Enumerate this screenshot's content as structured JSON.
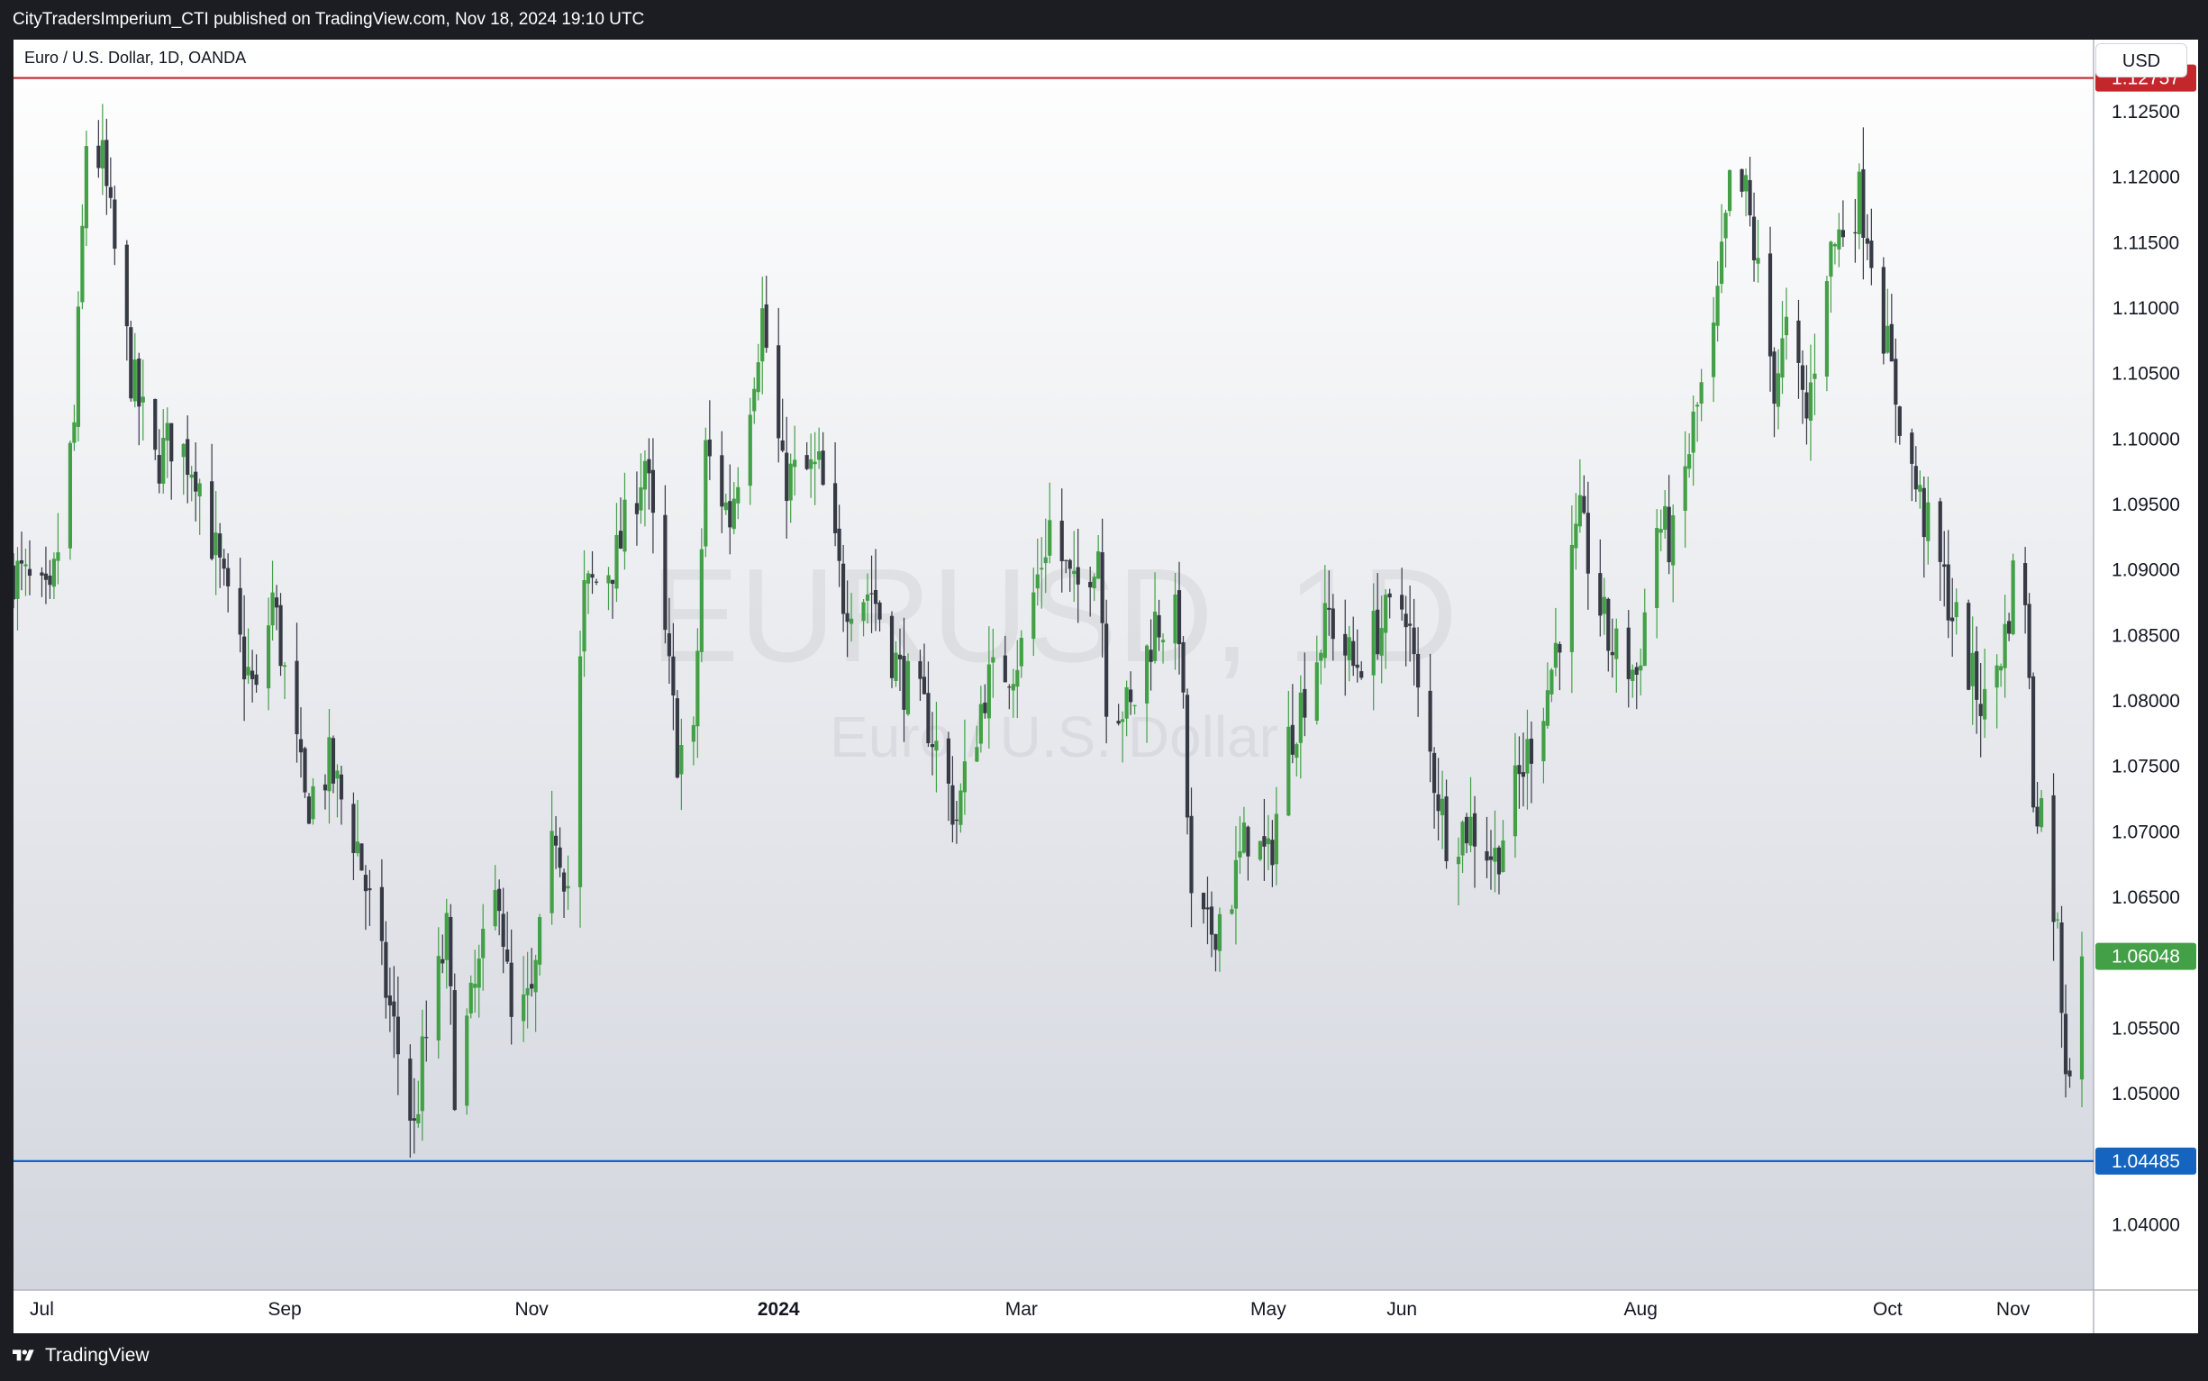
{
  "header": {
    "publish_info": "CityTradersImperium_CTI published on TradingView.com, Nov 18, 2024 19:10 UTC"
  },
  "chart": {
    "symbol_title": "Euro / U.S. Dollar, 1D, OANDA",
    "currency": "USD",
    "watermark_main": "EURUSD, 1D",
    "watermark_sub": "Euro / U.S. Dollar"
  },
  "footer": {
    "brand": "TradingView",
    "logo_icon": "tradingview-logo-icon"
  },
  "colors": {
    "up": "#43a047",
    "down": "#363a45",
    "resistance": "#c2282b",
    "support": "#1565c0",
    "last_price": "#43a047"
  },
  "chart_data": {
    "type": "candlestick",
    "symbol": "EURUSD",
    "interval": "1D",
    "broker": "OANDA",
    "ylim": [
      1.035,
      1.1305
    ],
    "y_ticks": [
      "1.04000",
      "1.04500",
      "1.05000",
      "1.05500",
      "1.06000",
      "1.06500",
      "1.07000",
      "1.07500",
      "1.08000",
      "1.08500",
      "1.09000",
      "1.09500",
      "1.10000",
      "1.10500",
      "1.11000",
      "1.11500",
      "1.12000",
      "1.12500"
    ],
    "y_tick_labels_shown": [
      "1.04000",
      "1.05000",
      "1.05500",
      "1.06500",
      "1.07000",
      "1.07500",
      "1.08000",
      "1.08500",
      "1.09000",
      "1.09500",
      "1.10000",
      "1.10500",
      "1.11000",
      "1.11500",
      "1.12000",
      "1.12500"
    ],
    "x_ticks": [
      {
        "label": "Jul",
        "date": "2023-07-03",
        "bold": false
      },
      {
        "label": "Sep",
        "date": "2023-09-01",
        "bold": false
      },
      {
        "label": "Nov",
        "date": "2023-11-01",
        "bold": false
      },
      {
        "label": "2024",
        "date": "2024-01-01",
        "bold": true
      },
      {
        "label": "Mar",
        "date": "2024-03-01",
        "bold": false
      },
      {
        "label": "May",
        "date": "2024-05-01",
        "bold": false
      },
      {
        "label": "Jun",
        "date": "2024-06-03",
        "bold": false
      },
      {
        "label": "Aug",
        "date": "2024-08-01",
        "bold": false
      },
      {
        "label": "Oct",
        "date": "2024-10-01",
        "bold": false
      },
      {
        "label": "Nov",
        "date": "2024-11-01",
        "bold": false
      }
    ],
    "horizontal_lines": [
      {
        "label": "1.12757",
        "value": 1.12757,
        "color": "#c2282b"
      },
      {
        "label": "1.04485",
        "value": 1.04485,
        "color": "#1565c0"
      }
    ],
    "last_price": {
      "label": "1.06048",
      "value": 1.06048
    },
    "anchors": [
      {
        "date": "2023-06-26",
        "close": 1.09
      },
      {
        "date": "2023-07-05",
        "close": 1.087
      },
      {
        "date": "2023-07-11",
        "close": 1.101
      },
      {
        "date": "2023-07-14",
        "close": 1.1228
      },
      {
        "date": "2023-07-18",
        "close": 1.121
      },
      {
        "date": "2023-07-25",
        "close": 1.105
      },
      {
        "date": "2023-07-31",
        "close": 1.098
      },
      {
        "date": "2023-08-04",
        "close": 1.1
      },
      {
        "date": "2023-08-10",
        "close": 1.098
      },
      {
        "date": "2023-08-18",
        "close": 1.087
      },
      {
        "date": "2023-08-25",
        "close": 1.08
      },
      {
        "date": "2023-08-29",
        "close": 1.088
      },
      {
        "date": "2023-09-06",
        "close": 1.072
      },
      {
        "date": "2023-09-12",
        "close": 1.075
      },
      {
        "date": "2023-09-19",
        "close": 1.069
      },
      {
        "date": "2023-09-26",
        "close": 1.058
      },
      {
        "date": "2023-10-03",
        "close": 1.047
      },
      {
        "date": "2023-10-05",
        "close": 1.0525
      },
      {
        "date": "2023-10-11",
        "close": 1.062
      },
      {
        "date": "2023-10-13",
        "close": 1.051
      },
      {
        "date": "2023-10-24",
        "close": 1.066
      },
      {
        "date": "2023-10-27",
        "close": 1.055
      },
      {
        "date": "2023-11-01",
        "close": 1.057
      },
      {
        "date": "2023-11-07",
        "close": 1.0703
      },
      {
        "date": "2023-11-10",
        "close": 1.066
      },
      {
        "date": "2023-11-14",
        "close": 1.088
      },
      {
        "date": "2023-11-22",
        "close": 1.091
      },
      {
        "date": "2023-11-29",
        "close": 1.0985
      },
      {
        "date": "2023-12-07",
        "close": 1.0762
      },
      {
        "date": "2023-12-11",
        "close": 1.0765
      },
      {
        "date": "2023-12-14",
        "close": 1.099
      },
      {
        "date": "2023-12-20",
        "close": 1.094
      },
      {
        "date": "2023-12-28",
        "close": 1.1095
      },
      {
        "date": "2024-01-02",
        "close": 1.097
      },
      {
        "date": "2024-01-11",
        "close": 1.0975
      },
      {
        "date": "2024-01-17",
        "close": 1.088
      },
      {
        "date": "2024-01-24",
        "close": 1.0885
      },
      {
        "date": "2024-01-31",
        "close": 1.082
      },
      {
        "date": "2024-02-07",
        "close": 1.0785
      },
      {
        "date": "2024-02-14",
        "close": 1.071
      },
      {
        "date": "2024-02-21",
        "close": 1.081
      },
      {
        "date": "2024-02-28",
        "close": 1.083
      },
      {
        "date": "2024-03-01",
        "close": 1.084
      },
      {
        "date": "2024-03-08",
        "close": 1.0935
      },
      {
        "date": "2024-03-14",
        "close": 1.088
      },
      {
        "date": "2024-03-20",
        "close": 1.092
      },
      {
        "date": "2024-03-22",
        "close": 1.0808
      },
      {
        "date": "2024-03-28",
        "close": 1.079
      },
      {
        "date": "2024-04-03",
        "close": 1.086
      },
      {
        "date": "2024-04-09",
        "close": 1.086
      },
      {
        "date": "2024-04-12",
        "close": 1.064
      },
      {
        "date": "2024-04-16",
        "close": 1.062
      },
      {
        "date": "2024-04-22",
        "close": 1.0655
      },
      {
        "date": "2024-04-26",
        "close": 1.07
      },
      {
        "date": "2024-05-01",
        "close": 1.0675
      },
      {
        "date": "2024-05-06",
        "close": 1.077
      },
      {
        "date": "2024-05-16",
        "close": 1.0865
      },
      {
        "date": "2024-05-22",
        "close": 1.0825
      },
      {
        "date": "2024-05-28",
        "close": 1.0855
      },
      {
        "date": "2024-06-04",
        "close": 1.0875
      },
      {
        "date": "2024-06-07",
        "close": 1.08
      },
      {
        "date": "2024-06-14",
        "close": 1.07
      },
      {
        "date": "2024-06-20",
        "close": 1.0705
      },
      {
        "date": "2024-06-26",
        "close": 1.068
      },
      {
        "date": "2024-07-02",
        "close": 1.074
      },
      {
        "date": "2024-07-09",
        "close": 1.081
      },
      {
        "date": "2024-07-17",
        "close": 1.0935
      },
      {
        "date": "2024-07-24",
        "close": 1.0845
      },
      {
        "date": "2024-07-31",
        "close": 1.082
      },
      {
        "date": "2024-08-05",
        "close": 1.0935
      },
      {
        "date": "2024-08-09",
        "close": 1.092
      },
      {
        "date": "2024-08-14",
        "close": 1.101
      },
      {
        "date": "2024-08-19",
        "close": 1.1075
      },
      {
        "date": "2024-08-23",
        "close": 1.119
      },
      {
        "date": "2024-08-27",
        "close": 1.1185
      },
      {
        "date": "2024-09-03",
        "close": 1.1043
      },
      {
        "date": "2024-09-06",
        "close": 1.108
      },
      {
        "date": "2024-09-11",
        "close": 1.1015
      },
      {
        "date": "2024-09-16",
        "close": 1.1135
      },
      {
        "date": "2024-09-20",
        "close": 1.1163
      },
      {
        "date": "2024-09-24",
        "close": 1.1185
      },
      {
        "date": "2024-09-26",
        "close": 1.1163
      },
      {
        "date": "2024-10-02",
        "close": 1.1048
      },
      {
        "date": "2024-10-07",
        "close": 1.0975
      },
      {
        "date": "2024-10-10",
        "close": 1.094
      },
      {
        "date": "2024-10-15",
        "close": 1.089
      },
      {
        "date": "2024-10-22",
        "close": 1.0815
      },
      {
        "date": "2024-10-25",
        "close": 1.0795
      },
      {
        "date": "2024-10-30",
        "close": 1.085
      },
      {
        "date": "2024-11-01",
        "close": 1.0893
      },
      {
        "date": "2024-11-04",
        "close": 1.0885
      },
      {
        "date": "2024-11-06",
        "close": 1.073
      },
      {
        "date": "2024-11-08",
        "close": 1.072
      },
      {
        "date": "2024-11-12",
        "close": 1.0622
      },
      {
        "date": "2024-11-14",
        "close": 1.0528
      },
      {
        "date": "2024-11-15",
        "close": 1.0532
      },
      {
        "date": "2024-11-18",
        "close": 1.06048
      }
    ]
  }
}
